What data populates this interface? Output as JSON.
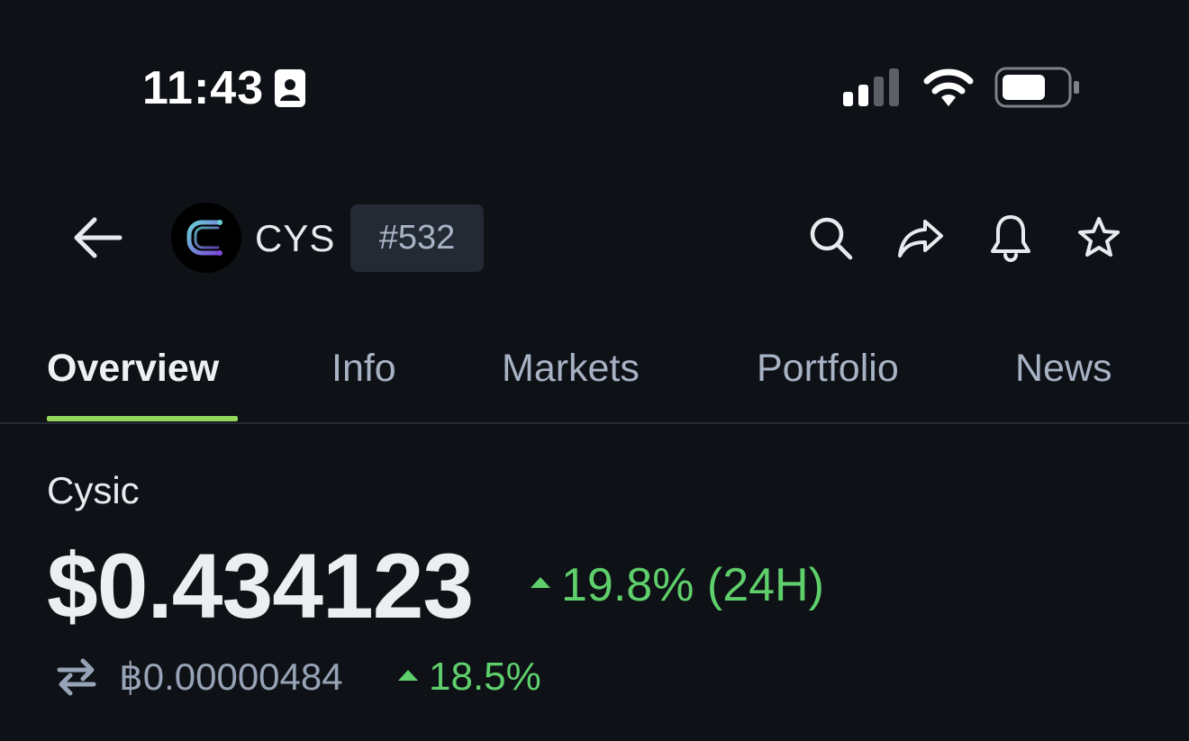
{
  "status_bar": {
    "time": "11:43"
  },
  "header": {
    "ticker": "CYS",
    "rank": "#532",
    "icons": [
      "back-arrow-icon",
      "search-icon",
      "share-icon",
      "bell-icon",
      "star-icon"
    ]
  },
  "tabs": [
    {
      "label": "Overview",
      "active": true
    },
    {
      "label": "Info",
      "active": false
    },
    {
      "label": "Markets",
      "active": false
    },
    {
      "label": "Portfolio",
      "active": false
    },
    {
      "label": "News",
      "active": false
    }
  ],
  "coin": {
    "name": "Cysic",
    "price": "$0.434123",
    "change_24h": "19.8% (24H)",
    "btc_price": "฿0.00000484",
    "btc_change": "18.5%"
  },
  "colors": {
    "background": "#0e1116",
    "accent_green": "#5fcf6c",
    "tab_underline": "#93d85a",
    "muted_text": "#a7b2c4"
  }
}
